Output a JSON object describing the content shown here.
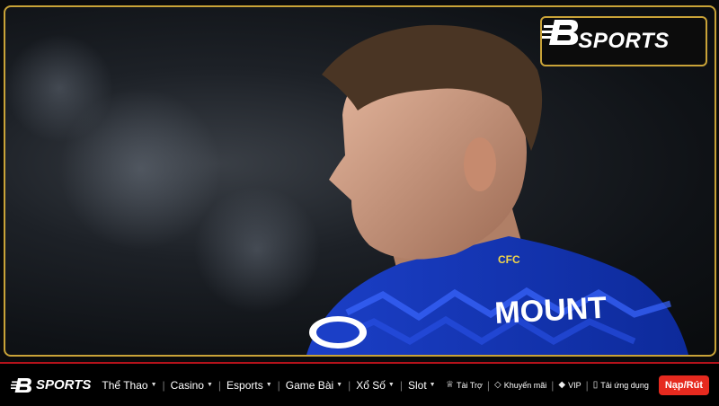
{
  "brand": {
    "name": "SPORTS",
    "logo_mark": "b-logo-icon",
    "accent": "#c9a338"
  },
  "hero": {
    "jersey_text": "MOUNT",
    "crest_text": "CFC",
    "sponsor_mark": "hyundai-logo"
  },
  "nav": {
    "menu": [
      {
        "label": "Thể Thao",
        "dropdown": true
      },
      {
        "label": "Casino",
        "dropdown": true
      },
      {
        "label": "Esports",
        "dropdown": true
      },
      {
        "label": "Game Bài",
        "dropdown": true
      },
      {
        "label": "Xổ Số",
        "dropdown": true
      },
      {
        "label": "Slot",
        "dropdown": true
      }
    ],
    "utilities": [
      {
        "label": "Tài Trợ",
        "icon": "trophy-icon"
      },
      {
        "label": "Khuyến mãi",
        "icon": "tag-icon"
      },
      {
        "label": "VIP",
        "icon": "diamond-icon"
      },
      {
        "label": "Tải ứng dụng",
        "icon": "phone-icon"
      }
    ],
    "cta_label": "Nạp/Rút",
    "cta_color": "#e62a1f"
  }
}
